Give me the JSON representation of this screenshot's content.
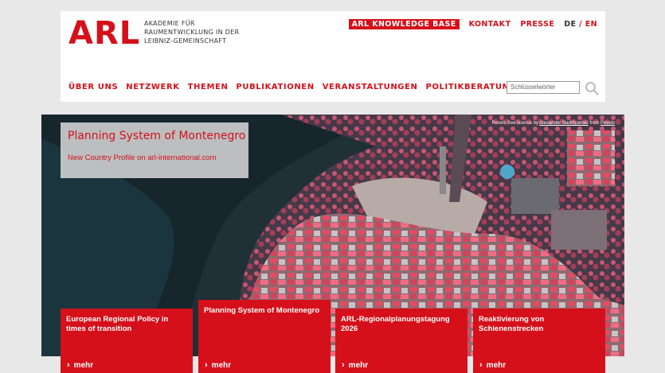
{
  "brand": {
    "logo": "ARL",
    "tagline": [
      "AKADEMIE FÜR",
      "RAUMENTWICKLUNG IN DER",
      "LEIBNIZ-GEMEINSCHAFT"
    ],
    "accent": "#d5101a"
  },
  "topnav": {
    "knowledge_base": "ARL KNOWLEDGE BASE",
    "kontakt": "KONTAKT",
    "presse": "PRESSE",
    "lang_de": "DE",
    "lang_sep": "/",
    "lang_en": "EN"
  },
  "mainnav": [
    "ÜBER UNS",
    "NETZWERK",
    "THEMEN",
    "PUBLIKATIONEN",
    "VERANSTALTUNGEN",
    "POLITIKBERATUNG"
  ],
  "search": {
    "placeholder": "Schlüsselwörter",
    "icon": "search-icon"
  },
  "hero": {
    "credit_prefix": "Pexels free license by",
    "credit_author": "Alexander Nadrilyanski",
    "credit_mid": "from",
    "credit_source": "Pexels",
    "title": "Planning System of Montenegro",
    "subtitle": "New Country Profile on arl-international.com"
  },
  "cards": [
    {
      "title": "European Regional Policy in times of transition",
      "more": "mehr"
    },
    {
      "title": "Planning System of Montenegro",
      "more": "mehr"
    },
    {
      "title": "ARL-Regionalplanungstagung 2026",
      "more": "mehr"
    },
    {
      "title": "Reaktivierung von Schienenstrecken",
      "more": "mehr"
    }
  ]
}
